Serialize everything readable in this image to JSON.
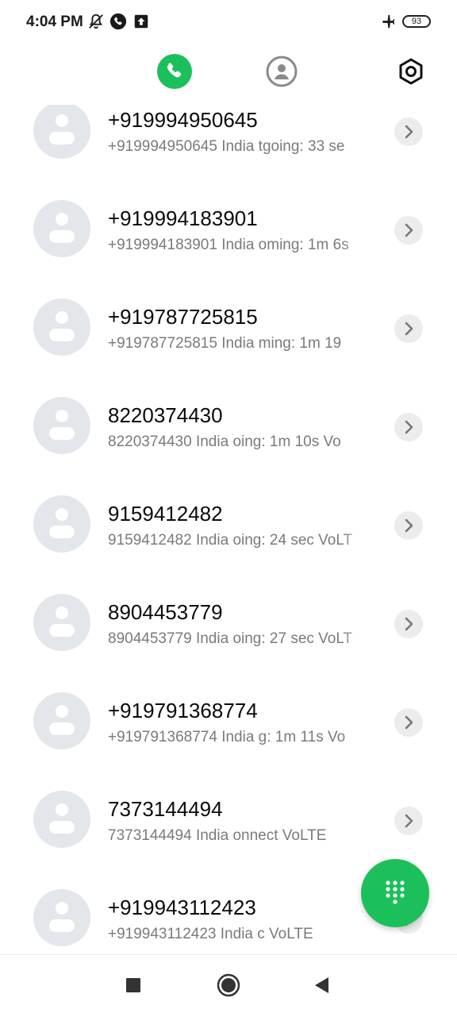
{
  "status_bar": {
    "time": "4:04 PM",
    "battery": "93",
    "icons": [
      "notifications-off-icon",
      "call-icon",
      "upload-icon",
      "airplane-icon",
      "battery-icon"
    ]
  },
  "tabs": [
    {
      "name": "recents",
      "icon": "phone-icon",
      "active": true
    },
    {
      "name": "contacts",
      "icon": "contact-icon",
      "active": false
    },
    {
      "name": "settings",
      "icon": "settings-icon",
      "active": false
    }
  ],
  "calls": [
    {
      "number": "+919994950645",
      "subtitle_number": "+919994950645",
      "location": "India",
      "detail": "tgoing: 33 se"
    },
    {
      "number": "+919994183901",
      "subtitle_number": "+919994183901",
      "location": "India",
      "detail": "oming: 1m 6s"
    },
    {
      "number": "+919787725815",
      "subtitle_number": "+919787725815",
      "location": "India",
      "detail": "ming: 1m 19"
    },
    {
      "number": "8220374430",
      "subtitle_number": "8220374430",
      "location": "India",
      "detail": "oing: 1m 10s Vo"
    },
    {
      "number": "9159412482",
      "subtitle_number": "9159412482",
      "location": "India",
      "detail": "oing: 24 sec VoLT"
    },
    {
      "number": "8904453779",
      "subtitle_number": "8904453779",
      "location": "India",
      "detail": "oing: 27 sec VoLT"
    },
    {
      "number": "+919791368774",
      "subtitle_number": "+919791368774",
      "location": "India",
      "detail": "g: 1m 11s Vo"
    },
    {
      "number": "7373144494",
      "subtitle_number": "7373144494",
      "location": "India",
      "detail": "onnect VoLTE"
    },
    {
      "number": "+919943112423",
      "subtitle_number": "+919943112423",
      "location": "India",
      "detail": "c VoLTE"
    }
  ],
  "fab": {
    "icon": "dialpad-icon"
  },
  "nav": [
    {
      "icon": "recent-apps-icon"
    },
    {
      "icon": "home-icon"
    },
    {
      "icon": "back-icon"
    }
  ],
  "colors": {
    "accent": "#1cc05b",
    "avatar_bg": "#e3e6ea",
    "subtitle": "#7a7a7a"
  }
}
